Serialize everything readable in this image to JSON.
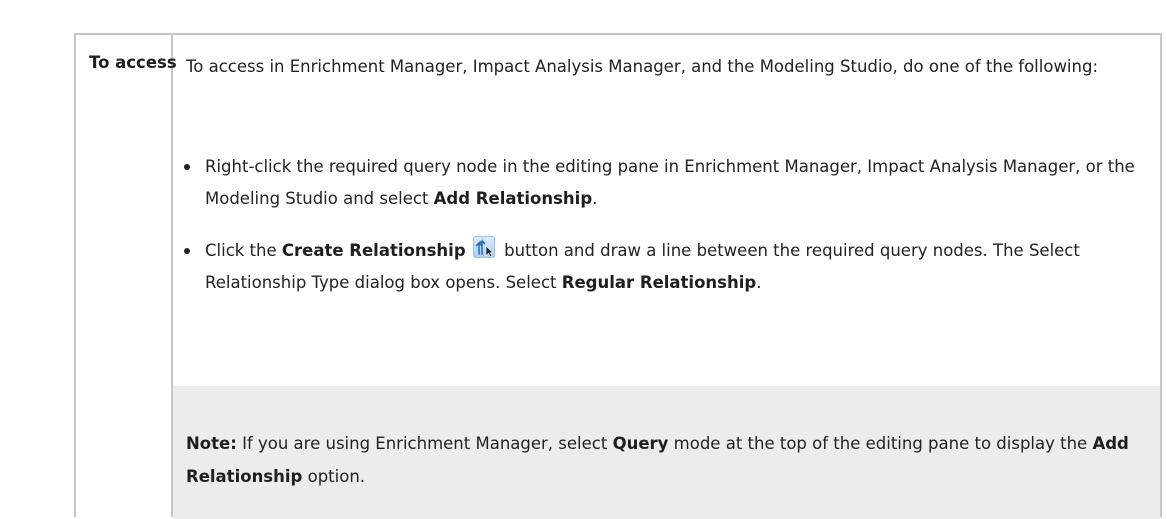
{
  "row": {
    "label": "To access",
    "intro": "To access in Enrichment Manager, Impact Analysis Manager, and the Modeling Studio, do one of the following:",
    "bullets": [
      {
        "text_before": "Right-click the required query node in the editing pane in Enrichment Manager, Impact Analysis Manager, or the Modeling Studio and select ",
        "bold": "Add Relationship",
        "text_after": "."
      },
      {
        "text_before": "Click the ",
        "bold1": "Create Relationship",
        "icon": "create-relationship-icon",
        "text_mid": " button and draw a line between the required query nodes. The Select Relationship Type dialog box opens. Select ",
        "bold2": "Regular Relationship",
        "text_after": "."
      }
    ],
    "note": {
      "label": "Note:",
      "text1": " If you are using Enrichment Manager, select ",
      "bold1": "Query",
      "text2": " mode at the top of the editing pane to display the ",
      "bold2": "Add Relationship",
      "text3": " option."
    }
  },
  "colors": {
    "border": "#c6c6c6",
    "note_bg": "#ececec",
    "text": "#222222",
    "icon_blue": "#3a7fd1"
  }
}
